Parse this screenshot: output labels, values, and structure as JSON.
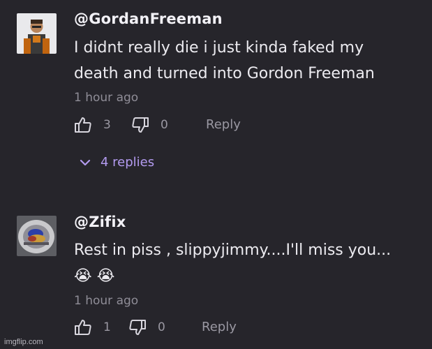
{
  "comments": [
    {
      "username": "@GordanFreeman",
      "lines": [
        "I didnt really die i just kinda faked my",
        "death and turned into Gordon Freeman"
      ],
      "time": "1 hour ago",
      "likes": "3",
      "dislikes": "0",
      "reply_label": "Reply",
      "replies_label": "4 replies"
    },
    {
      "username": "@Zifix",
      "lines": [
        "Rest in piss , slippyjimmy....I'll miss you...",
        "😭 😭"
      ],
      "time": "1 hour ago",
      "likes": "1",
      "dislikes": "0",
      "reply_label": "Reply"
    }
  ],
  "watermark": "imgflip.com",
  "colors": {
    "background": "#26252b",
    "accent": "#b39bf0",
    "muted": "#9a98a2"
  },
  "icons": [
    "thumbs-up-icon",
    "thumbs-down-icon",
    "chevron-down-icon"
  ]
}
